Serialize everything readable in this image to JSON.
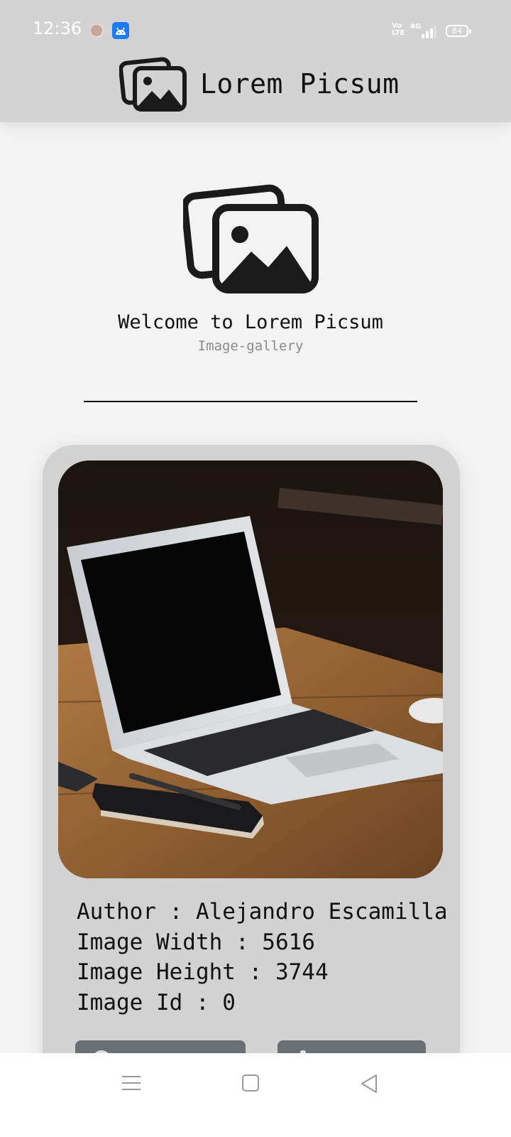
{
  "status_bar": {
    "time": "12:36",
    "volte": "Vo\nLTE",
    "network": "4G",
    "battery": "84"
  },
  "app_bar": {
    "title": "Lorem Picsum"
  },
  "hero": {
    "welcome": "Welcome to Lorem Picsum",
    "subtitle": "Image-gallery"
  },
  "card": {
    "image_description_icon": "laptop-on-desk-photo",
    "author": "Author : Alejandro Escamilla",
    "width": "Image Width : 5616",
    "height": "Image Height : 3744",
    "id": "Image Id : 0"
  },
  "colors": {
    "app_bar": "#d3d3d3",
    "background": "#f3f3f3",
    "card": "#d2d2d2",
    "button": "#6a6f74"
  },
  "nav_bar": {
    "icons": [
      "menu-icon",
      "home-icon",
      "back-icon"
    ]
  }
}
